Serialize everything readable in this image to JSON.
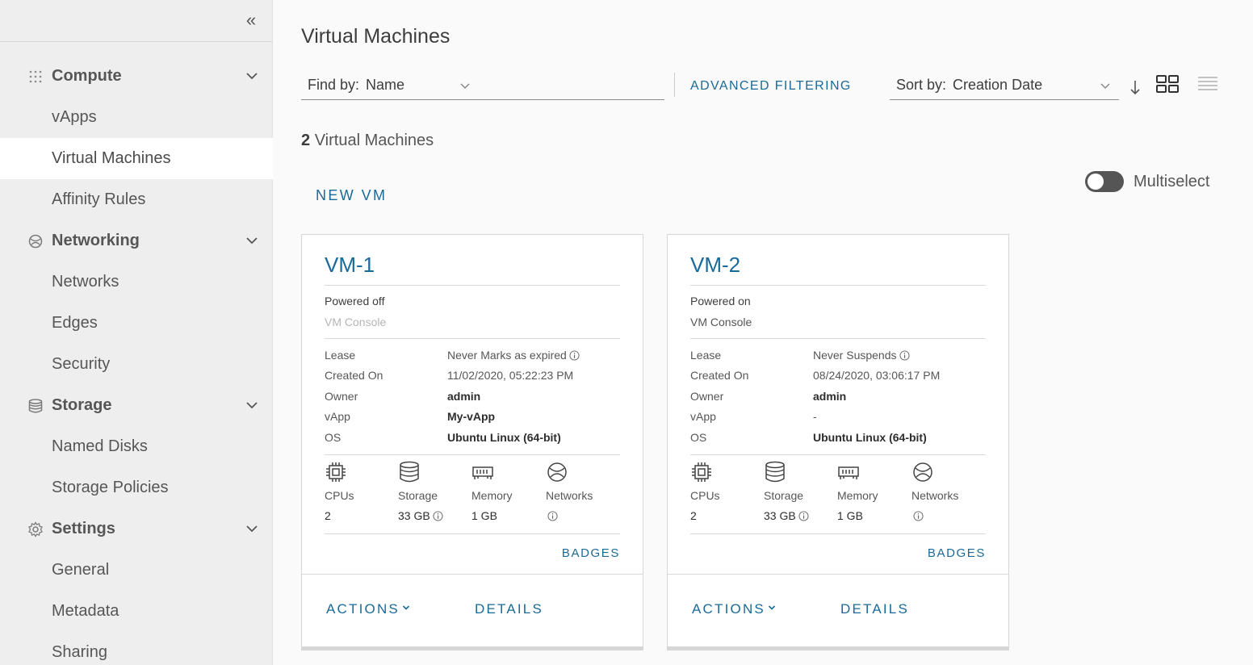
{
  "sidebar": {
    "sections": [
      {
        "label": "Compute",
        "icon": "grid-dots-icon",
        "items": [
          "vApps",
          "Virtual Machines",
          "Affinity Rules"
        ]
      },
      {
        "label": "Networking",
        "icon": "network-globe-icon",
        "items": [
          "Networks",
          "Edges",
          "Security"
        ]
      },
      {
        "label": "Storage",
        "icon": "database-icon",
        "items": [
          "Named Disks",
          "Storage Policies"
        ]
      },
      {
        "label": "Settings",
        "icon": "gear-icon",
        "items": [
          "General",
          "Metadata",
          "Sharing"
        ]
      }
    ],
    "active_item": "Virtual Machines"
  },
  "main": {
    "title": "Virtual Machines",
    "find_by": {
      "label": "Find by:",
      "value": "Name"
    },
    "advanced_filtering": "ADVANCED FILTERING",
    "sort_by": {
      "label": "Sort by:",
      "value": "Creation Date"
    },
    "count": {
      "number": "2",
      "label": "Virtual Machines"
    },
    "new_vm": "NEW VM",
    "multiselect": {
      "label": "Multiselect",
      "on": false
    }
  },
  "labels": {
    "lease": "Lease",
    "created_on": "Created On",
    "owner": "Owner",
    "vapp": "vApp",
    "os": "OS",
    "cpus": "CPUs",
    "storage": "Storage",
    "memory": "Memory",
    "networks": "Networks",
    "badges": "BADGES",
    "actions": "ACTIONS",
    "details": "DETAILS"
  },
  "vms": [
    {
      "name": "VM-1",
      "power_state": "Powered off",
      "console": "VM Console",
      "lease": "Never Marks as expired",
      "created_on": "11/02/2020, 05:22:23 PM",
      "owner": "admin",
      "vapp": "My-vApp",
      "os": "Ubuntu Linux (64-bit)",
      "cpus": "2",
      "storage": "33 GB",
      "memory": "1 GB"
    },
    {
      "name": "VM-2",
      "power_state": "Powered on",
      "console": "VM Console",
      "lease": "Never Suspends",
      "created_on": "08/24/2020, 03:06:17 PM",
      "owner": "admin",
      "vapp": "-",
      "os": "Ubuntu Linux (64-bit)",
      "cpus": "2",
      "storage": "33 GB",
      "memory": "1 GB"
    }
  ]
}
